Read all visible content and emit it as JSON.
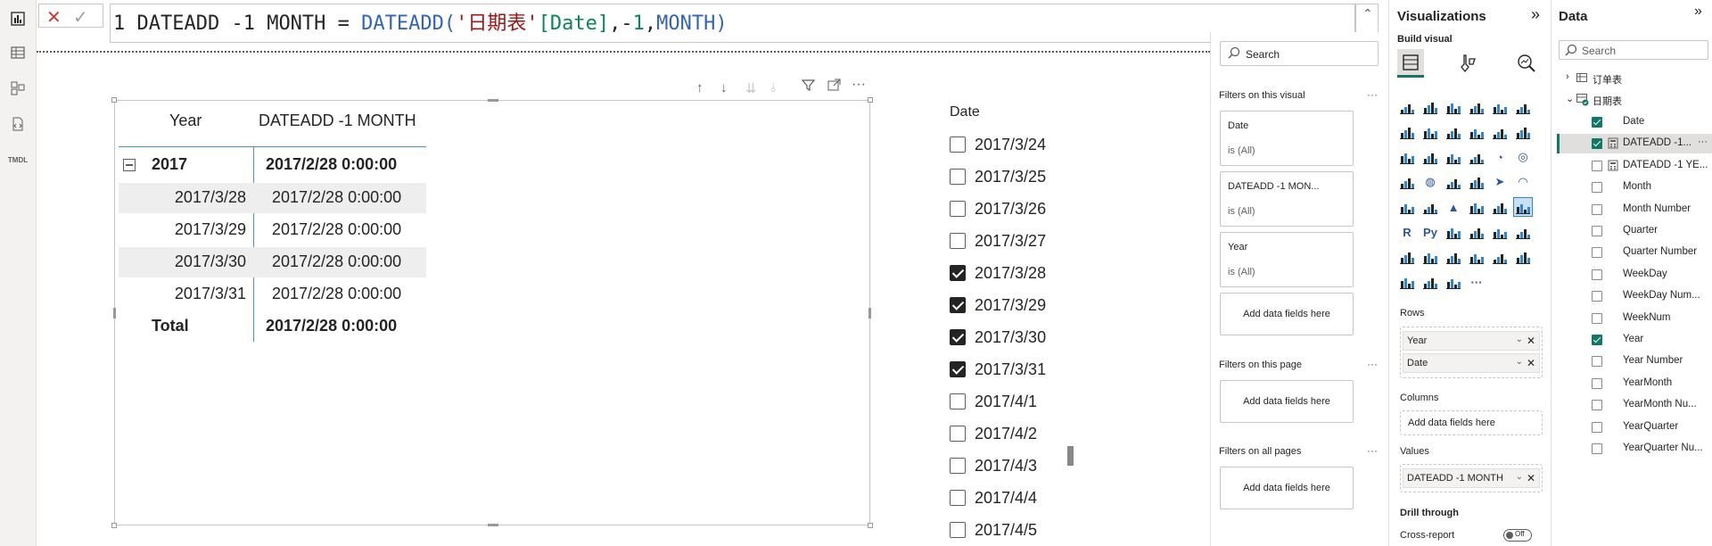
{
  "formula": {
    "line_no": "1",
    "measure_name": "DATEADD -1 MONTH",
    "equals": " = ",
    "func": "DATEADD",
    "open": "(",
    "table_ref": "'日期表'",
    "column_ref": "[Date]",
    "sep1": ",",
    "minus": "-",
    "num": "1",
    "sep2": ",",
    "interval": "MONTH",
    "close": ")"
  },
  "matrix": {
    "col1_header": "Year",
    "col2_header": "DATEADD -1 MONTH",
    "group_label": "2017",
    "group_value": "2017/2/28 0:00:00",
    "rows": [
      {
        "date": "2017/3/28",
        "value": "2017/2/28 0:00:00"
      },
      {
        "date": "2017/3/29",
        "value": "2017/2/28 0:00:00"
      },
      {
        "date": "2017/3/30",
        "value": "2017/2/28 0:00:00"
      },
      {
        "date": "2017/3/31",
        "value": "2017/2/28 0:00:00"
      }
    ],
    "total_label": "Total",
    "total_value": "2017/2/28 0:00:00"
  },
  "slicer": {
    "title": "Date",
    "items": [
      {
        "label": "2017/3/24",
        "checked": false
      },
      {
        "label": "2017/3/25",
        "checked": false
      },
      {
        "label": "2017/3/26",
        "checked": false
      },
      {
        "label": "2017/3/27",
        "checked": false
      },
      {
        "label": "2017/3/28",
        "checked": true
      },
      {
        "label": "2017/3/29",
        "checked": true
      },
      {
        "label": "2017/3/30",
        "checked": true
      },
      {
        "label": "2017/3/31",
        "checked": true
      },
      {
        "label": "2017/4/1",
        "checked": false
      },
      {
        "label": "2017/4/2",
        "checked": false
      },
      {
        "label": "2017/4/3",
        "checked": false
      },
      {
        "label": "2017/4/4",
        "checked": false
      },
      {
        "label": "2017/4/5",
        "checked": false
      }
    ]
  },
  "filters": {
    "search_placeholder": "Search",
    "on_visual_label": "Filters on this visual",
    "visual_filters": [
      {
        "name": "Date",
        "state": "is (All)"
      },
      {
        "name": "DATEADD -1 MON...",
        "state": "is (All)"
      },
      {
        "name": "Year",
        "state": "is (All)"
      }
    ],
    "add_fields": "Add data fields here",
    "on_page_label": "Filters on this page",
    "on_all_pages_label": "Filters on all pages",
    "more": "···"
  },
  "viz": {
    "title": "Visualizations",
    "build_label": "Build visual",
    "rows_label": "Rows",
    "rows": [
      "Year",
      "Date"
    ],
    "columns_label": "Columns",
    "columns_placeholder": "Add data fields here",
    "values_label": "Values",
    "values": [
      "DATEADD -1 MONTH"
    ],
    "drill_label": "Drill through",
    "cross_report_label": "Cross-report",
    "toggle_text": "Off",
    "expand_icon": "»",
    "more": "···"
  },
  "data_pane": {
    "title": "Data",
    "expand_icon": "»",
    "search_placeholder": "Search",
    "tables": [
      "订单表",
      "日期表"
    ],
    "fields": [
      {
        "name": "Date",
        "checked": true,
        "calc": false
      },
      {
        "name": "DATEADD -1...",
        "checked": true,
        "calc": true
      },
      {
        "name": "DATEADD -1 YE...",
        "checked": false,
        "calc": true
      },
      {
        "name": "Month",
        "checked": false,
        "calc": false
      },
      {
        "name": "Month Number",
        "checked": false,
        "calc": false
      },
      {
        "name": "Quarter",
        "checked": false,
        "calc": false
      },
      {
        "name": "Quarter Number",
        "checked": false,
        "calc": false
      },
      {
        "name": "WeekDay",
        "checked": false,
        "calc": false
      },
      {
        "name": "WeekDay Num...",
        "checked": false,
        "calc": false
      },
      {
        "name": "WeekNum",
        "checked": false,
        "calc": false
      },
      {
        "name": "Year",
        "checked": true,
        "calc": false
      },
      {
        "name": "Year Number",
        "checked": false,
        "calc": false
      },
      {
        "name": "YearMonth",
        "checked": false,
        "calc": false
      },
      {
        "name": "YearMonth Nu...",
        "checked": false,
        "calc": false
      },
      {
        "name": "YearQuarter",
        "checked": false,
        "calc": false
      },
      {
        "name": "YearQuarter Nu...",
        "checked": false,
        "calc": false
      }
    ],
    "more": "···"
  },
  "colors": {
    "accent_teal": "#117865",
    "dax_function": "#3165bb",
    "dax_column": "#098658",
    "dax_table": "#a31515"
  }
}
